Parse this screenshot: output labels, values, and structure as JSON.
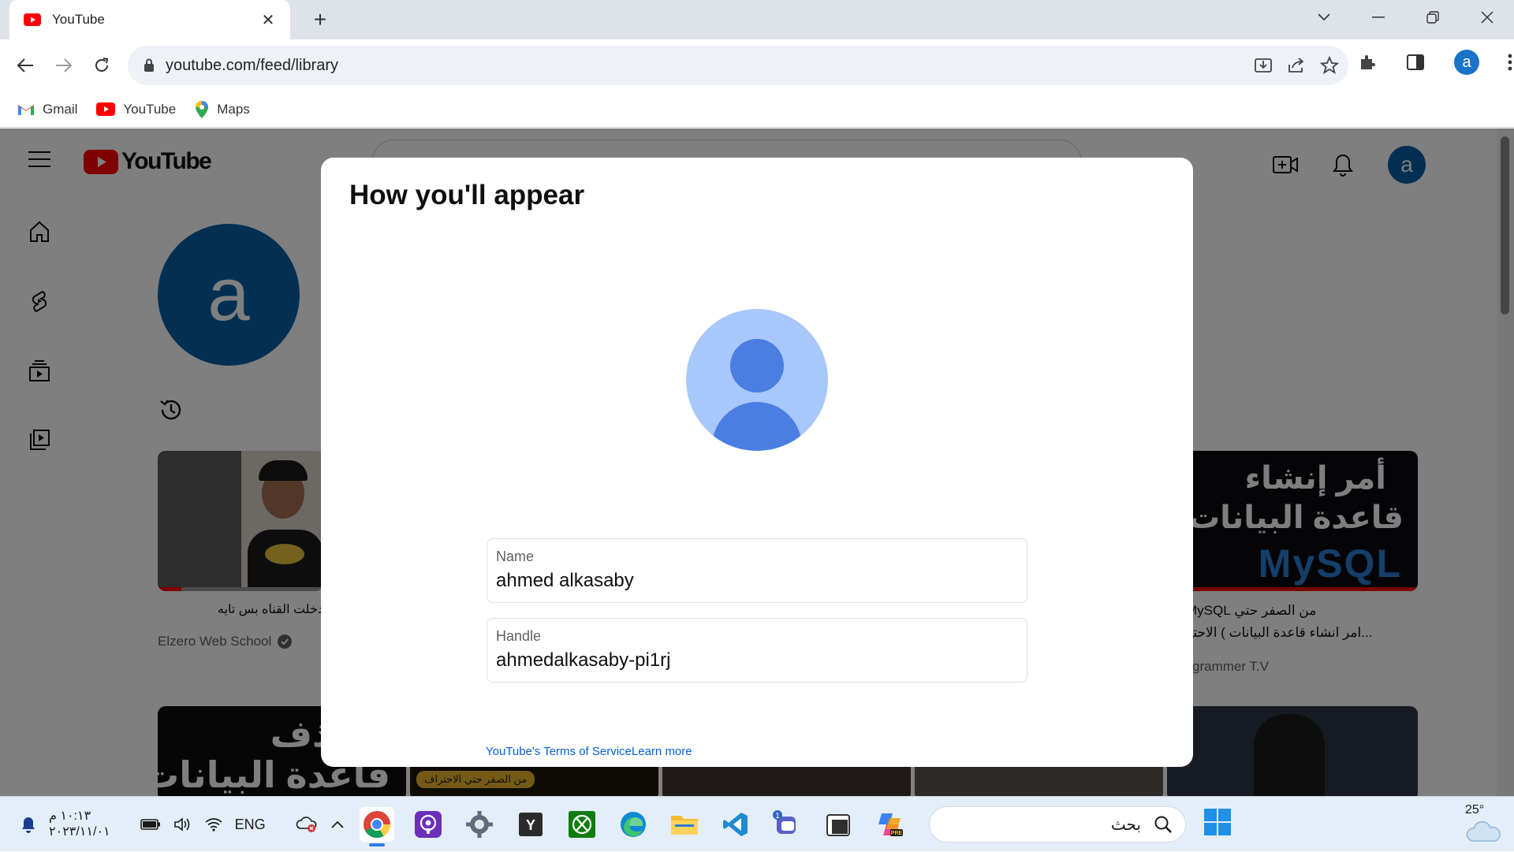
{
  "browser": {
    "tab": {
      "title": "YouTube"
    },
    "address": {
      "url": "youtube.com/feed/library"
    },
    "profile_initial": "a",
    "bookmarks": [
      {
        "label": "Gmail"
      },
      {
        "label": "YouTube"
      },
      {
        "label": "Maps"
      }
    ]
  },
  "youtube": {
    "profile_initial": "a",
    "videos": [
      {
        "title": "دخلت القناه بس تايه",
        "channel": "Elzero Web School",
        "verified": true
      },
      {
        "title_line1": "من الصفر حتي MySQL",
        "title_line2": "...امر انشاء قاعدة البيانات ) الاحتر",
        "channel": "grammer T.V",
        "thumb_text_1": "أمر إنشاء",
        "thumb_text_2": "قاعدة البيانات",
        "thumb_text_3": "MySQL"
      }
    ],
    "row2": [
      {
        "thumb_text_1": "ر حذف",
        "thumb_text_2": "قاعدة البيانات"
      },
      {
        "tag": "من الصفر حتي الاحتراف"
      }
    ]
  },
  "dialog": {
    "title": "How you'll appear",
    "name_label": "Name",
    "name_value": "ahmed alkasaby",
    "handle_label": "Handle",
    "handle_value": "ahmedalkasaby-pi1rj",
    "terms_link": "YouTube's Terms of Service",
    "learn_more_link": "Learn more"
  },
  "taskbar": {
    "time": "١٠:١٣ م",
    "date": "٢٠٢٣/١١/٠١",
    "language": "ENG",
    "search_text": "بحث",
    "weather_temp": "25°",
    "apps": [
      "chrome-icon",
      "podcast-app-icon",
      "settings-icon",
      "yandex-icon",
      "xbox-icon",
      "edge-icon",
      "file-explorer-icon",
      "vscode-icon",
      "teams-icon",
      "notepad-icon",
      "copilot-icon"
    ]
  },
  "colors": {
    "accent": "#065fa4",
    "youtube_red": "#ff0000",
    "link": "#065fd4",
    "avatar_bg": "#a8c7fa",
    "avatar_fg": "#4b7ee2"
  }
}
